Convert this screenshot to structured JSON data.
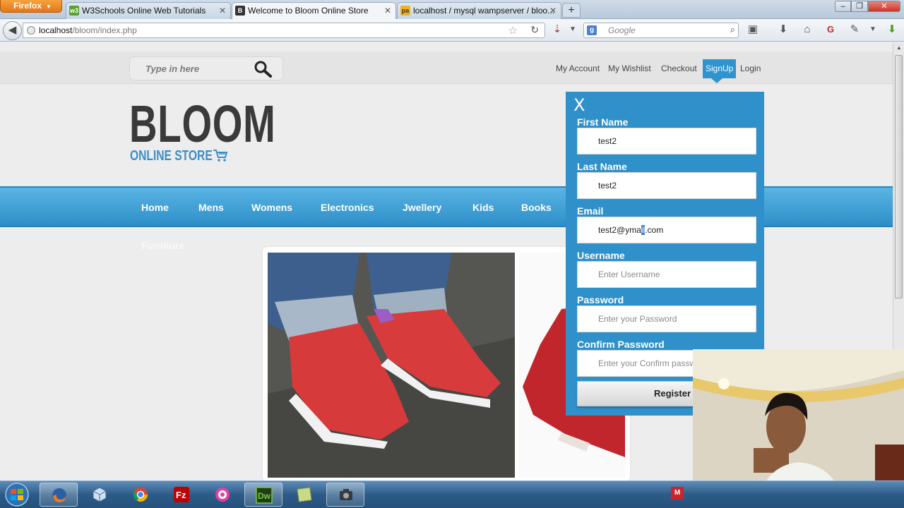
{
  "browser": {
    "menu_button": "Firefox",
    "tabs": [
      {
        "title": "W3Schools Online Web Tutorials",
        "icon": "w3schools-icon"
      },
      {
        "title": "Welcome to Bloom Online Store",
        "icon": "bloom-b-icon"
      },
      {
        "title": "localhost / mysql wampserver / bloo...",
        "icon": "phpmyadmin-icon"
      }
    ],
    "new_tab": "+",
    "window_controls": {
      "minimize": "‒",
      "restore": "❐",
      "close": "✕"
    },
    "url_host": "localhost",
    "url_path": "/bloom/index.php",
    "search_placeholder": "Google"
  },
  "site": {
    "search_placeholder": "Type in here",
    "top_links": [
      "My Account",
      "My Wishlist",
      "Checkout",
      "SignUp",
      "Login"
    ],
    "active_top_link": "SignUp",
    "logo": {
      "brand": "BLOOM",
      "tagline": "ONLINE STORE"
    },
    "nav": [
      "Home",
      "Mens",
      "Womens",
      "Electronics",
      "Jwellery",
      "Kids",
      "Books",
      "Furniture"
    ]
  },
  "signup": {
    "close_label": "X",
    "fields": [
      {
        "label": "First Name",
        "value": "test2",
        "placeholder": ""
      },
      {
        "label": "Last Name",
        "value": "test2",
        "placeholder": ""
      },
      {
        "label": "Email",
        "value_before": "test2@yma",
        "value_selected": "il",
        "value_after": ".com",
        "placeholder": ""
      },
      {
        "label": "Username",
        "value": "",
        "placeholder": "Enter Username"
      },
      {
        "label": "Password",
        "value": "",
        "placeholder": "Enter your Password"
      },
      {
        "label": "Confirm Password",
        "value": "",
        "placeholder": "Enter your Confirm password"
      }
    ],
    "register_label": "Register"
  },
  "colors": {
    "accent": "#3090c9",
    "nav_gradient_top": "#5ab4e4",
    "nav_gradient_bottom": "#2d8fc8",
    "firefox_button": "#e3761c"
  },
  "taskbar": {
    "apps": [
      "firefox-icon",
      "virtualbox-icon",
      "chrome-icon",
      "filezilla-icon",
      "wamp-icon",
      "dreamweaver-icon",
      "notes-icon",
      "camera-icon"
    ],
    "dreamweaver_label": "Dw",
    "filezilla_label": "Fz",
    "tray_badge": "M"
  }
}
